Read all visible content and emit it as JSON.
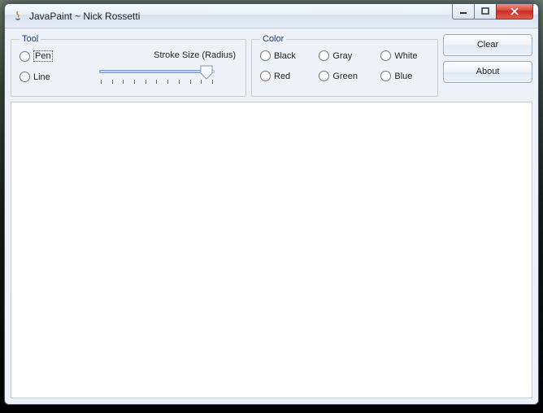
{
  "window": {
    "title": "JavaPaint ~ Nick Rossetti"
  },
  "tool_group": {
    "legend": "Tool",
    "pen": "Pen",
    "line": "Line",
    "stroke_label": "Stroke Size (Radius)"
  },
  "color_group": {
    "legend": "Color",
    "black": "Black",
    "gray": "Gray",
    "white": "White",
    "red": "Red",
    "green": "Green",
    "blue": "Blue"
  },
  "buttons": {
    "clear": "Clear",
    "about": "About"
  }
}
